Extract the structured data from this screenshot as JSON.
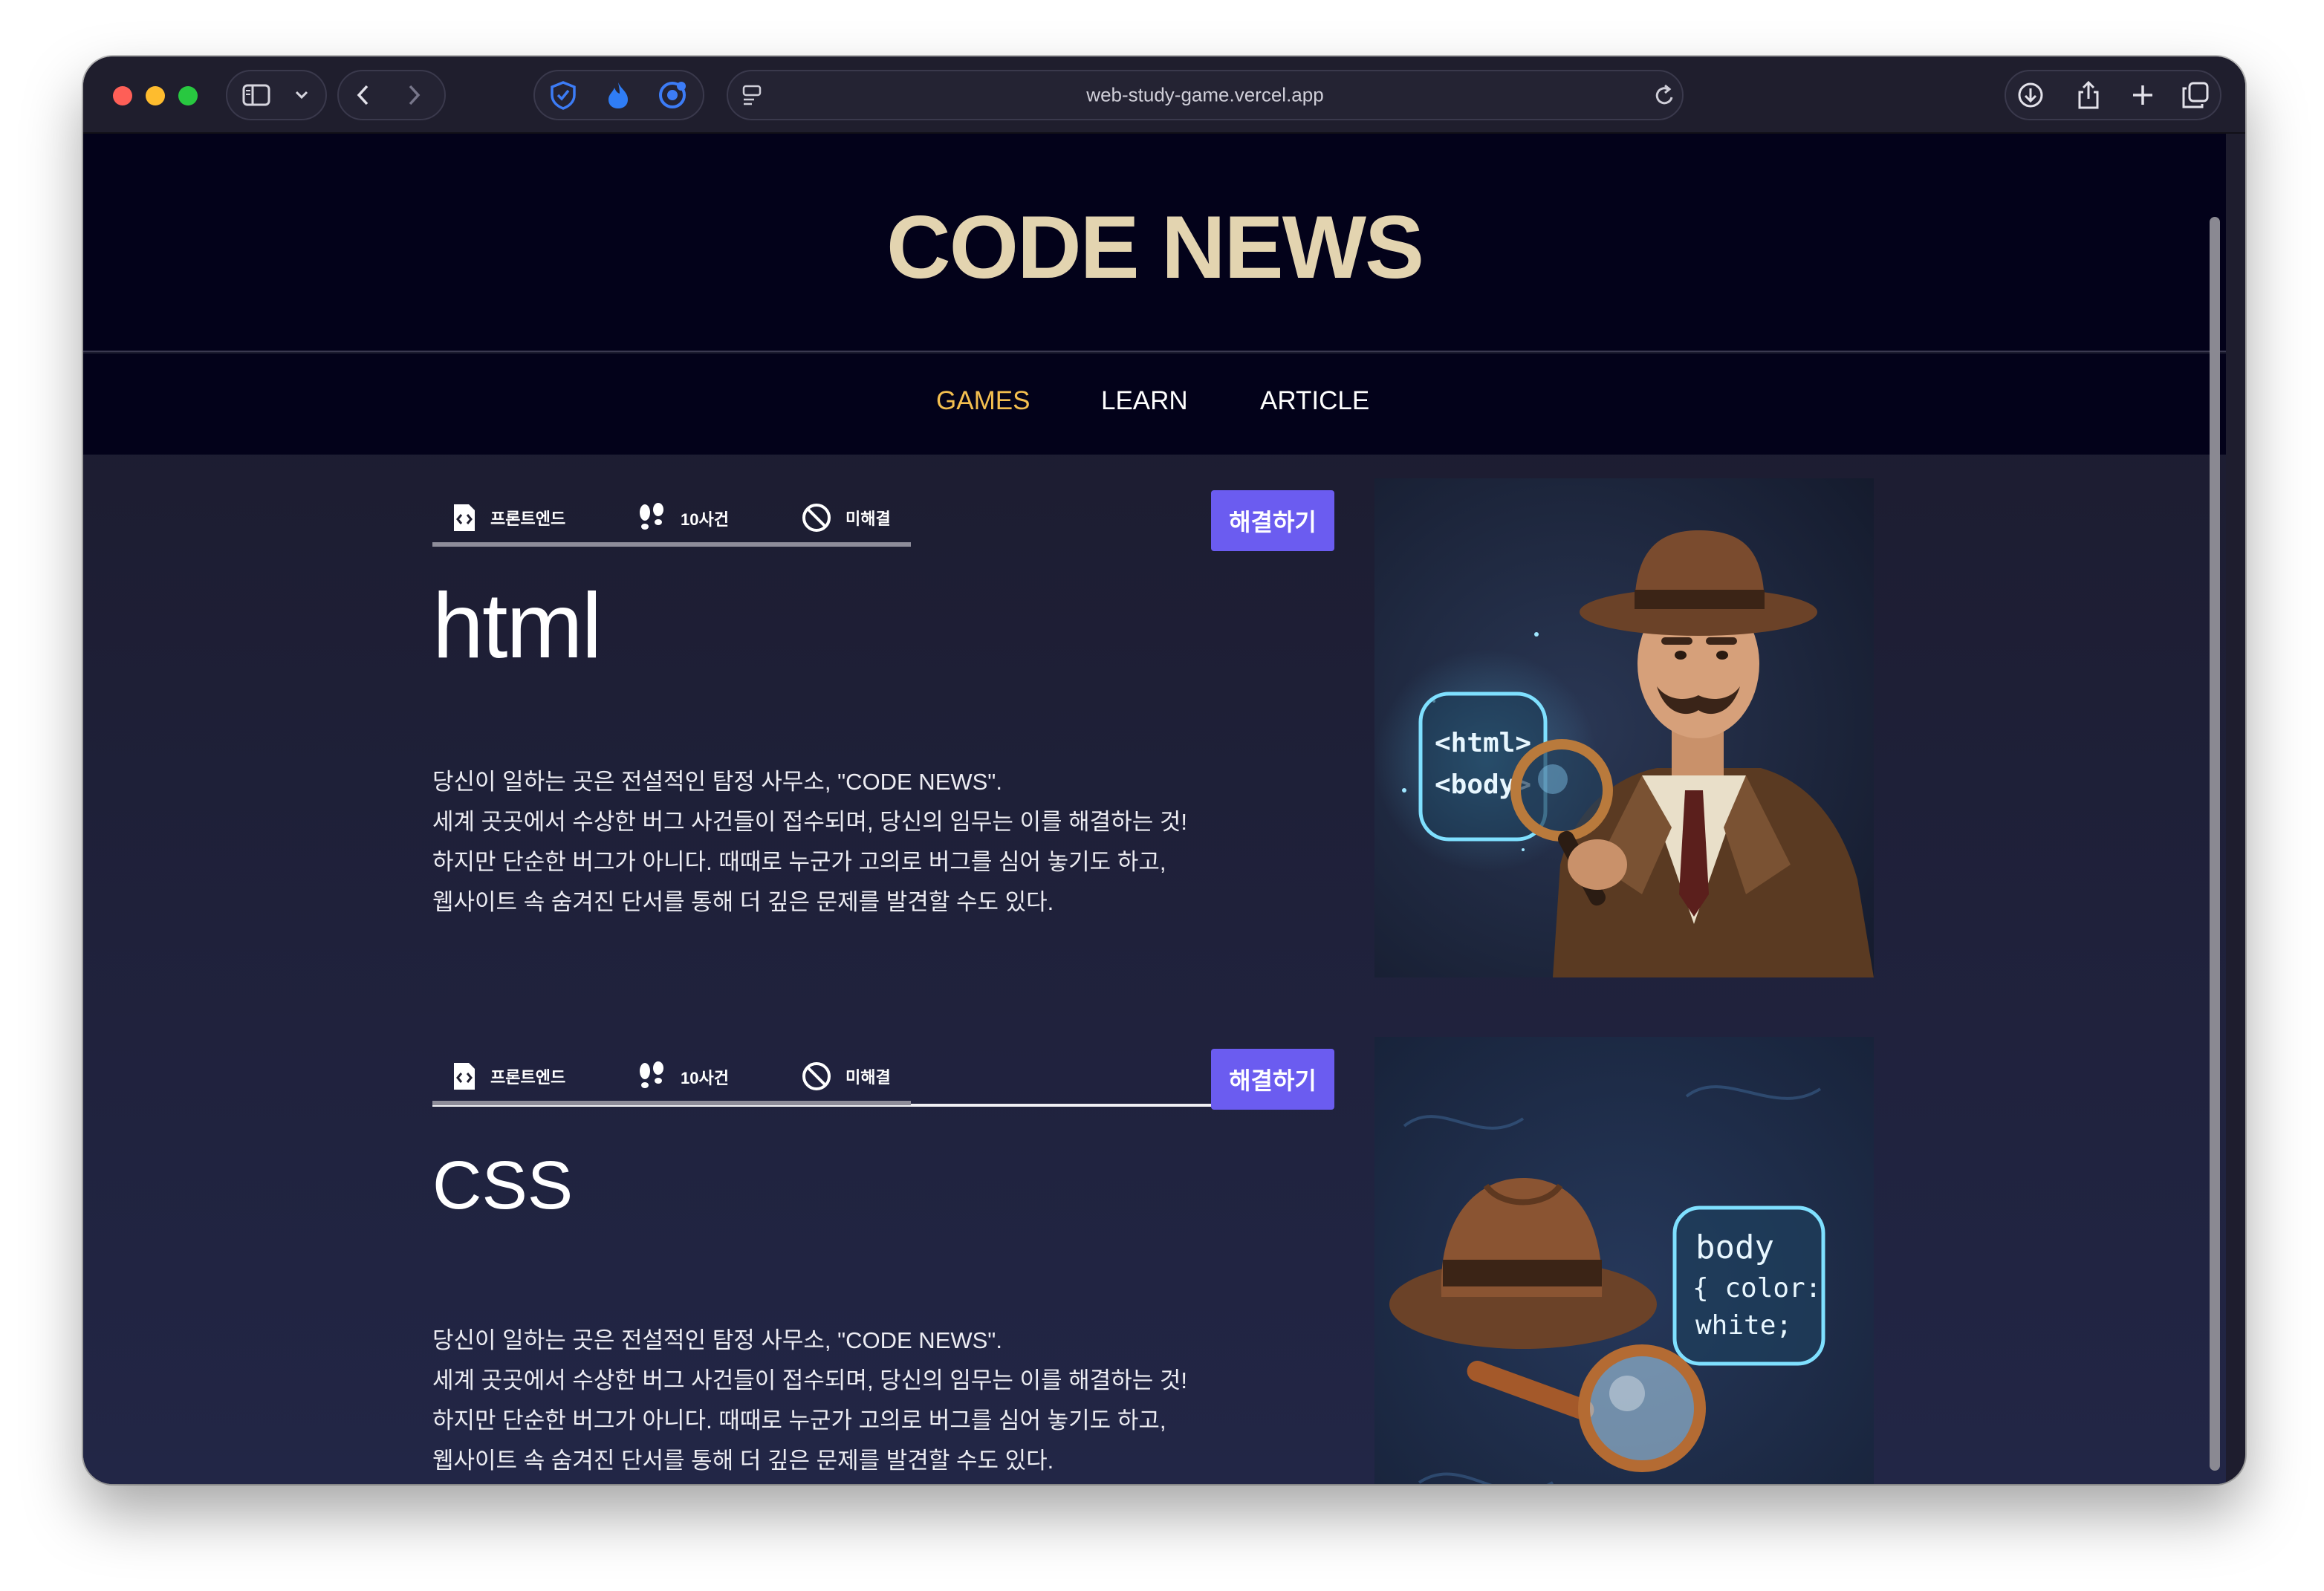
{
  "browser": {
    "url": "web-study-game.vercel.app",
    "icons": [
      "sidebar-icon",
      "chevron-down-icon",
      "back-icon",
      "forward-icon",
      "shield-icon",
      "flame-icon",
      "badge-icon",
      "page-settings-icon",
      "reload-icon",
      "download-icon",
      "share-icon",
      "plus-icon",
      "tabs-icon"
    ]
  },
  "site": {
    "logo": "CODE NEWS",
    "nav": [
      {
        "label": "GAMES",
        "active": true
      },
      {
        "label": "LEARN",
        "active": false
      },
      {
        "label": "ARTICLE",
        "active": false
      }
    ]
  },
  "cards": [
    {
      "category": "프론트엔드",
      "cases": "10사건",
      "status": "미해결",
      "button": "해결하기",
      "title": "html",
      "description": "당신이 일하는 곳은 전설적인 탐정 사무소, \"CODE NEWS\".\n세계 곳곳에서 수상한 버그 사건들이 접수되며, 당신의 임무는 이를 해결하는 것!\n하지만 단순한 버그가 아니다. 때때로 누군가 고의로 버그를 심어 놓기도 하고,\n웹사이트 속 숨겨진 단서를 통해 더 깊은 문제를 발견할 수도 있다.",
      "image_text": [
        "<html>",
        "<body>"
      ]
    },
    {
      "category": "프론트엔드",
      "cases": "10사건",
      "status": "미해결",
      "button": "해결하기",
      "title": "CSS",
      "description": "당신이 일하는 곳은 전설적인 탐정 사무소, \"CODE NEWS\".\n세계 곳곳에서 수상한 버그 사건들이 접수되며, 당신의 임무는 이를 해결하는 것!\n하지만 단순한 버그가 아니다. 때때로 누군가 고의로 버그를 심어 놓기도 하고,\n웹사이트 속 숨겨진 단서를 통해 더 깊은 문제를 발견할 수도 있다.",
      "image_text": [
        "body",
        "{ color:",
        "white;"
      ]
    }
  ],
  "colors": {
    "accent": "#6b5cf0",
    "logo": "#e3d4b0",
    "nav_active": "#f4bf4f",
    "header_bg": "#03021a"
  }
}
